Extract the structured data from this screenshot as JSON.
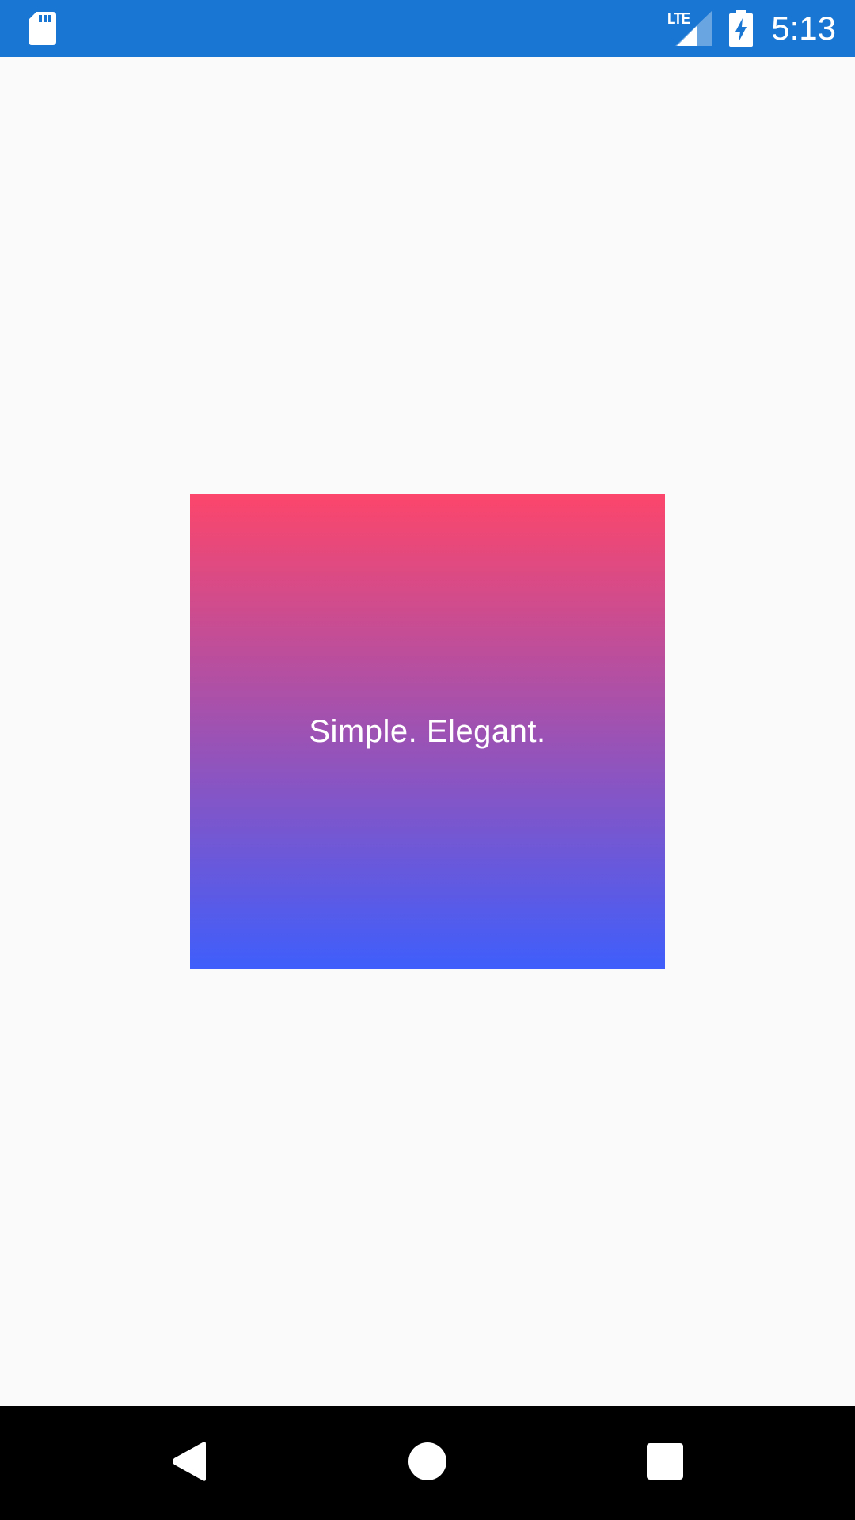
{
  "status_bar": {
    "network_label": "LTE",
    "time": "5:13",
    "background_color": "#1976d2",
    "icons": [
      "sd-card-icon",
      "lte-signal-icon",
      "battery-charging-icon"
    ]
  },
  "card": {
    "text": "Simple. Elegant.",
    "gradient_start": "#fc466b",
    "gradient_end": "#3f5efb"
  },
  "nav_bar": {
    "buttons": [
      "back-icon",
      "home-icon",
      "recents-icon"
    ]
  }
}
